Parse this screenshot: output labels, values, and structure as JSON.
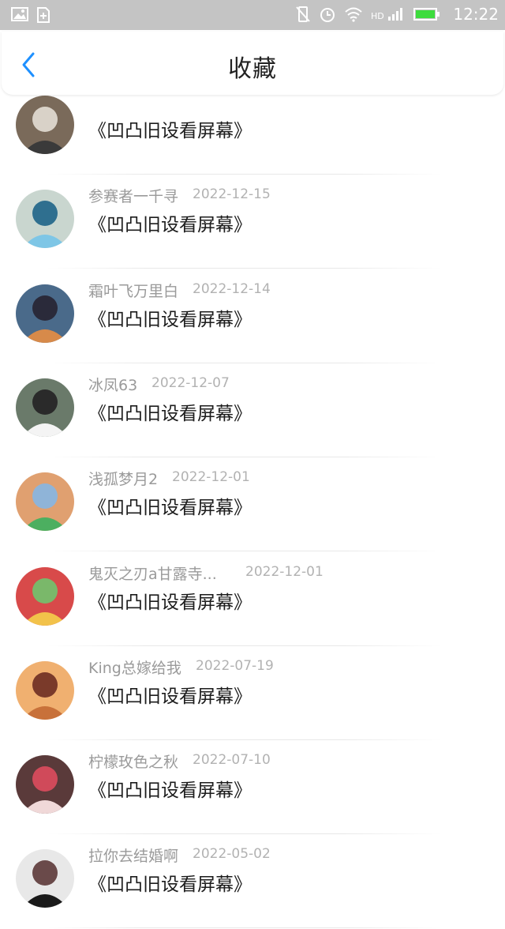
{
  "status_bar": {
    "time": "12:22",
    "battery_color": "#3ddc3d"
  },
  "header": {
    "title": "收藏",
    "accent_color": "#1e90ff"
  },
  "favorites": [
    {
      "user": "",
      "date": "",
      "title": "《凹凸旧设看屏幕》"
    },
    {
      "user": "参赛者一千寻",
      "date": "2022-12-15",
      "title": "《凹凸旧设看屏幕》"
    },
    {
      "user": "霜叶飞万里白",
      "date": "2022-12-14",
      "title": "《凹凸旧设看屏幕》"
    },
    {
      "user": "冰凤63",
      "date": "2022-12-07",
      "title": "《凹凸旧设看屏幕》"
    },
    {
      "user": "浅孤梦月2",
      "date": "2022-12-01",
      "title": "《凹凸旧设看屏幕》"
    },
    {
      "user": "鬼灭之刃a甘露寺...",
      "date": "2022-12-01",
      "title": "《凹凸旧设看屏幕》"
    },
    {
      "user": "King总嫁给我",
      "date": "2022-07-19",
      "title": "《凹凸旧设看屏幕》"
    },
    {
      "user": "柠檬玫色之秋",
      "date": "2022-07-10",
      "title": "《凹凸旧设看屏幕》"
    },
    {
      "user": "拉你去结婚啊",
      "date": "2022-05-02",
      "title": "《凹凸旧设看屏幕》"
    }
  ]
}
